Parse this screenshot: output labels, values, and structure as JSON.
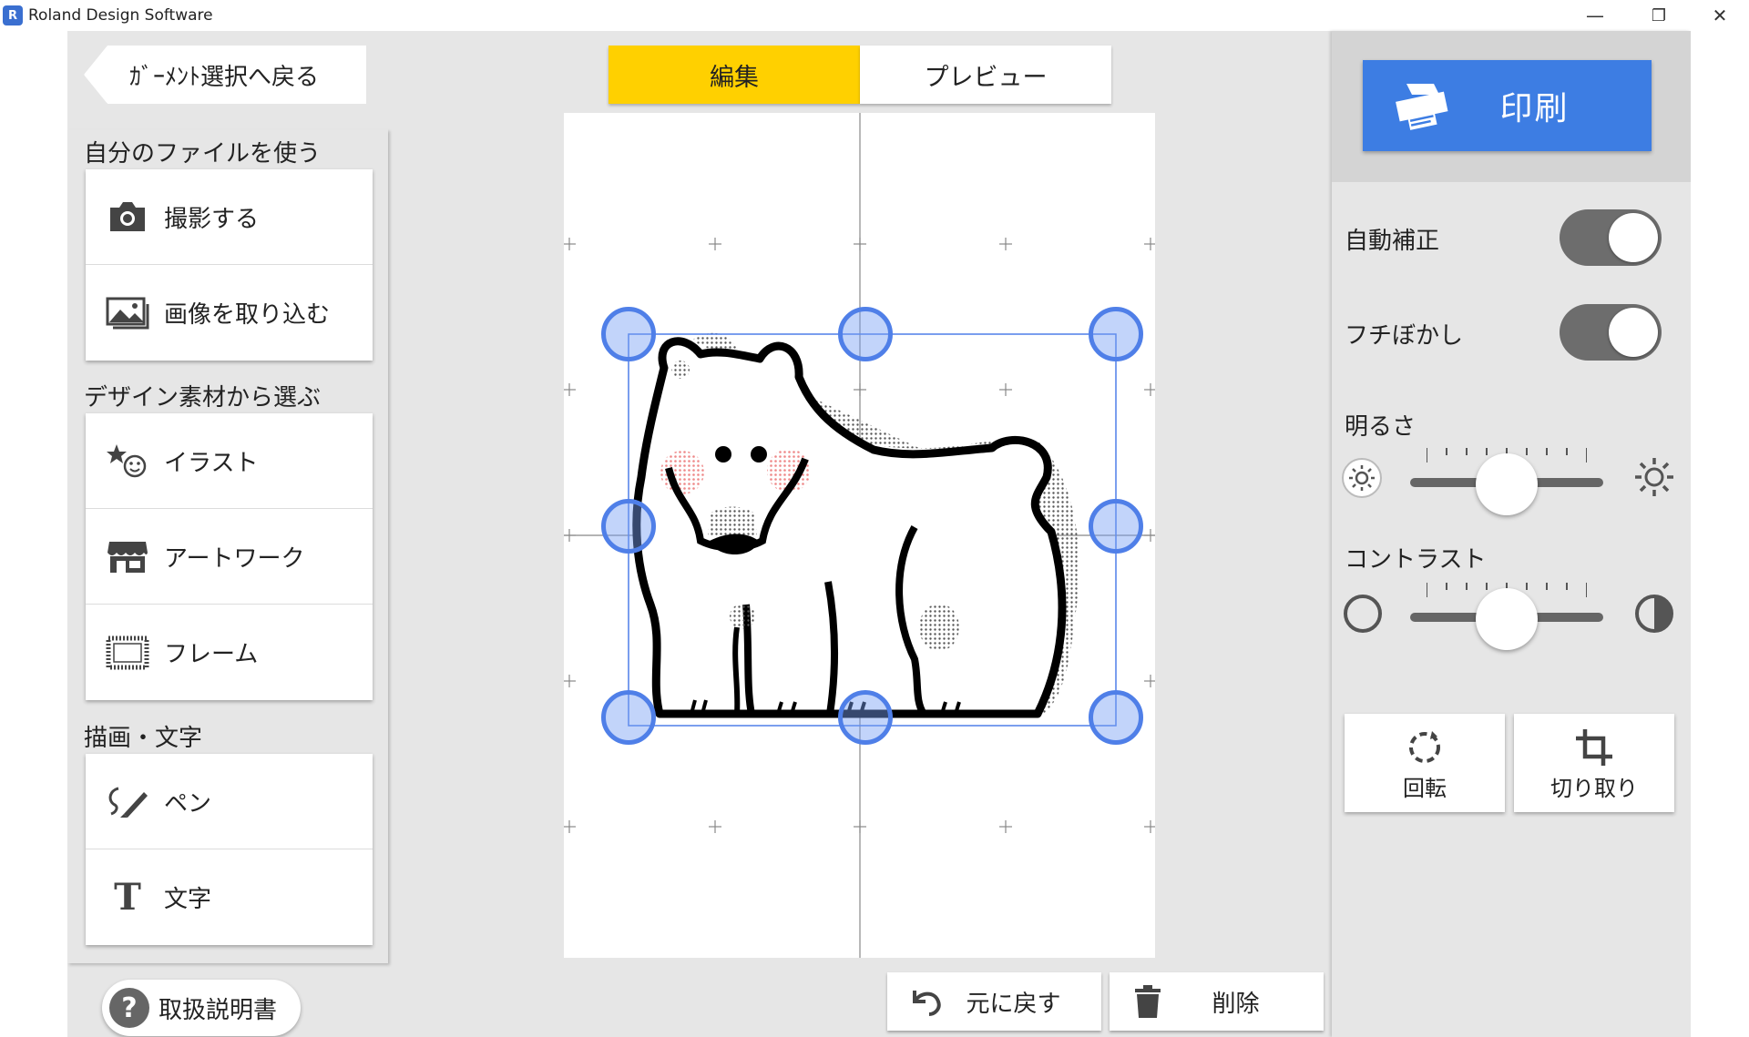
{
  "window": {
    "title": "Roland Design Software",
    "minimize_glyph": "—",
    "restore_glyph": "❐",
    "close_glyph": "✕"
  },
  "left": {
    "back_label": "ｶﾞｰﾒﾝﾄ選択へ戻る",
    "section_files": "自分のファイルを使う",
    "photo_label": "撮影する",
    "import_label": "画像を取り込む",
    "section_design": "デザイン素材から選ぶ",
    "illust_label": "イラスト",
    "artwork_label": "アートワーク",
    "frame_label": "フレーム",
    "section_draw": "描画・文字",
    "pen_label": "ペン",
    "text_label": "文字",
    "manual_label": "取扱説明書",
    "text_icon_glyph": "T"
  },
  "tabs": {
    "edit": "編集",
    "preview": "プレビュー"
  },
  "bottom": {
    "undo_label": "元に戻す",
    "delete_label": "削除"
  },
  "right": {
    "print_label": "印刷",
    "auto_correct_label": "自動補正",
    "auto_correct_on": true,
    "edge_blur_label": "フチぼかし",
    "edge_blur_on": true,
    "brightness_label": "明るさ",
    "brightness_value": 0.5,
    "contrast_label": "コントラスト",
    "contrast_value": 0.5,
    "rotate_label": "回転",
    "crop_label": "切り取り"
  },
  "colors": {
    "accent_tab": "#ffd000",
    "print_button": "#3d7de3",
    "selection_handle": "#4f7fe8"
  }
}
